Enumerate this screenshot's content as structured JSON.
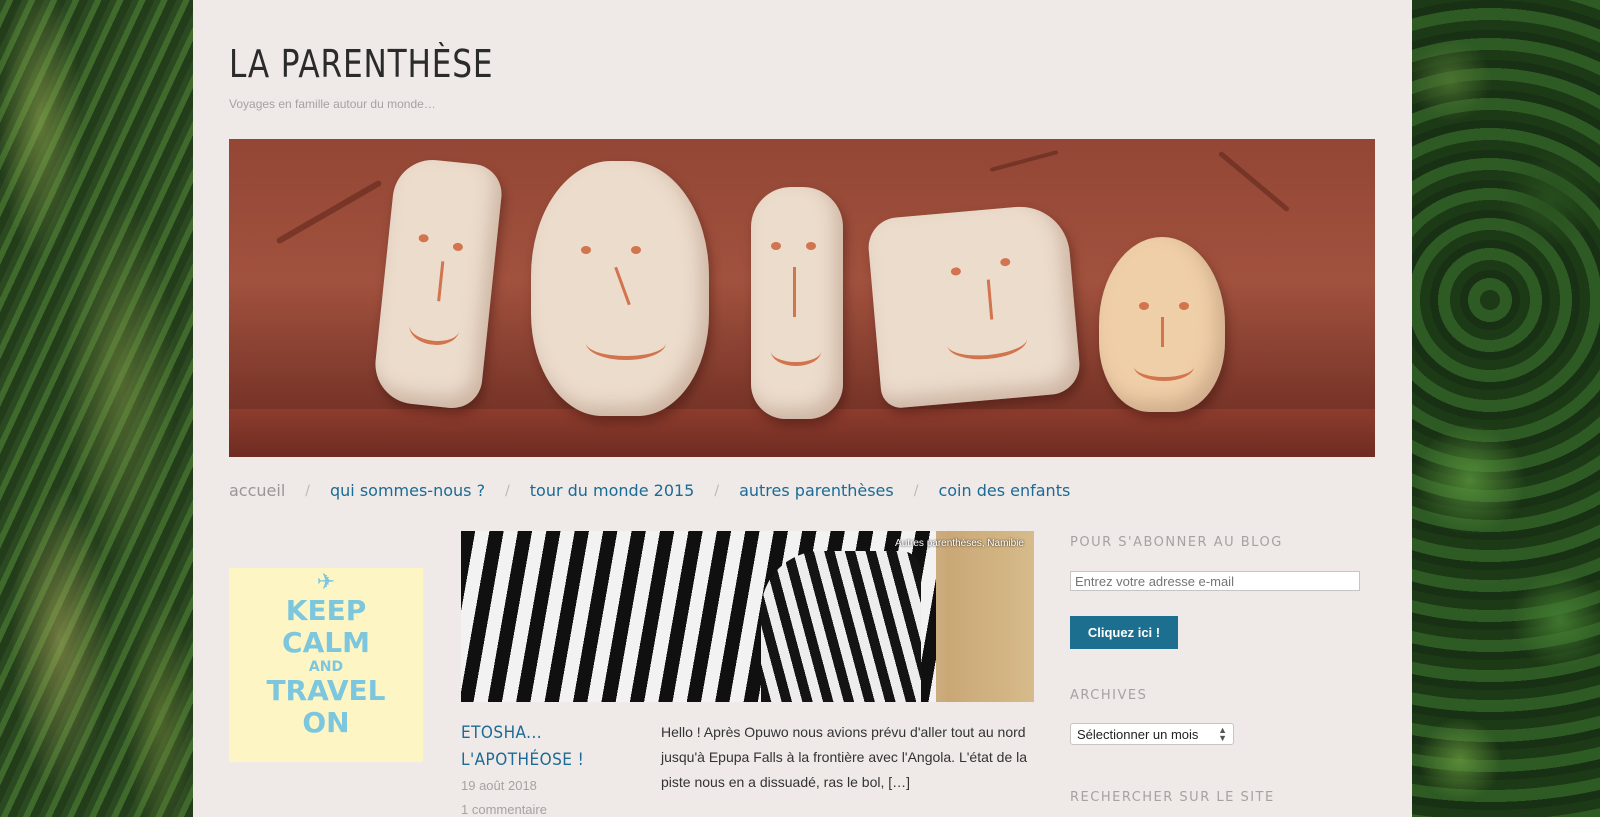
{
  "site": {
    "title": "LA PARENTHÈSE",
    "tagline": "Voyages en famille autour du monde…"
  },
  "nav": {
    "items": [
      {
        "label": "accueil",
        "current": true
      },
      {
        "label": "qui sommes-nous ?"
      },
      {
        "label": "tour du monde 2015"
      },
      {
        "label": "autres parenthèses"
      },
      {
        "label": "coin des enfants"
      }
    ],
    "separator": "/"
  },
  "poster": {
    "icon": "airplane-icon",
    "lines": [
      "KEEP",
      "CALM",
      "AND",
      "TRAVEL",
      "ON"
    ]
  },
  "post": {
    "categories": "Autres parenthèses, Namibie",
    "title_line1": "ETOSHA...",
    "title_line2": "L'APOTHÉOSE !",
    "date": "19 août 2018",
    "comments": "1 commentaire",
    "excerpt": "Hello ! Après Opuwo nous avions prévu d'aller tout au nord jusqu'à Epupa Falls à la frontière avec l'Angola. L'état de la piste nous en a dissuadé, ras le bol, […]"
  },
  "sidebar": {
    "subscribe_title": "POUR S'ABONNER AU BLOG",
    "email_placeholder": "Entrez votre adresse e-mail",
    "subscribe_button": "Cliquez ici !",
    "archives_title": "ARCHIVES",
    "archives_select": "Sélectionner un mois",
    "search_title": "RECHERCHER SUR LE SITE"
  },
  "colors": {
    "link": "#1a6b95",
    "button": "#1d6f8f",
    "page_bg": "#efe9e8",
    "muted": "#a7a2a2"
  }
}
